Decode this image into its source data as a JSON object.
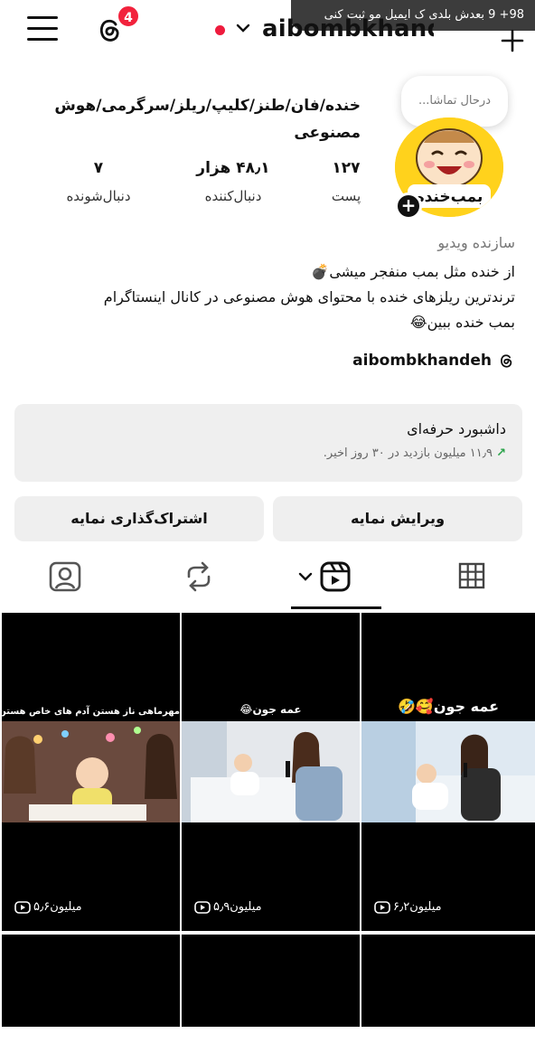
{
  "toast": {
    "text": "98+ 9 بعدش بلدی ک ایمیل مو ثبت کنی"
  },
  "topbar": {
    "username": "aibombkhandeh",
    "badge_count": "4"
  },
  "note": {
    "text": "درحال تماشا..."
  },
  "profile": {
    "name": "خنده/فان/طنز/کلیپ/ریلز/سرگرمی/هوش مصنوعی",
    "stats": [
      {
        "num": "۱۲۷",
        "label": "پست"
      },
      {
        "num": "۴۸٫۱ هزار",
        "label": "دنبال‌کننده"
      },
      {
        "num": "۷",
        "label": "دنبال‌شونده"
      }
    ],
    "category": "سازنده ویدیو",
    "bio_line1": "از خنده مثل بمب منفجر میشی💣",
    "bio_line2": "ترندترین ریلزهای خنده با محتوای هوش مصنوعی در کانال اینستاگرام",
    "bio_line3": "بمب خنده ببین😂",
    "threads_handle": "aibombkhandeh"
  },
  "dashboard": {
    "title": "داشبورد حرفه‌ای",
    "subtitle": "۱۱٫۹ میلیون بازدید در ۳۰ روز اخیر.",
    "arrow": "↗"
  },
  "buttons": {
    "edit": "ویرایش نمایه",
    "share": "اشتراک‌گذاری نمایه"
  },
  "grid": [
    {
      "caption": "عمه جون🥰🤣",
      "views": "۶٫۲میلیون"
    },
    {
      "caption": "عمه جون😂",
      "views": "۵٫۹میلیون"
    },
    {
      "caption": "مهرماهی ناز هستن آدم های خاص هستن",
      "views": "۵٫۶میلیون"
    }
  ],
  "colors": {
    "badge": "#f2223c",
    "accent_green": "#2aa34a",
    "avatar_bg": "#ffd21c"
  }
}
